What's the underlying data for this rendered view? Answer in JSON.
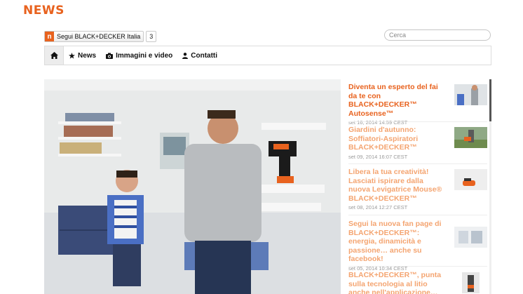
{
  "header": {
    "title": "NEWS"
  },
  "follow": {
    "logo": "n",
    "label": "Segui BLACK+DECKER Italia",
    "count": "3"
  },
  "search": {
    "placeholder": "Cerca"
  },
  "nav": {
    "home_icon": "home-icon",
    "items": [
      {
        "label": "News",
        "icon": "star-icon"
      },
      {
        "label": "Immagini e video",
        "icon": "camera-icon"
      },
      {
        "label": "Contatti",
        "icon": "user-icon"
      }
    ]
  },
  "hero": {
    "image": "man-and-boy-with-drill-at-shelf-photo"
  },
  "articles": [
    {
      "title": "Diventa un esperto del fai da te con BLACK+DECKER™ Autosense™",
      "date": "set 16, 2014 14:59 CEST",
      "active": true,
      "thumb": "man-with-tool-thumbnail"
    },
    {
      "title": "Giardini d'autunno: Soffiatori-Aspiratori BLACK+DECKER™",
      "date": "set 09, 2014 16:07 CEST",
      "active": false,
      "thumb": "garden-blower-thumbnail"
    },
    {
      "title": "Libera la tua creatività! Lasciati ispirare dalla nuova Levigatrice Mouse® BLACK+DECKER™",
      "date": "set 08, 2014 12:27 CEST",
      "active": false,
      "thumb": "sander-mouse-thumbnail"
    },
    {
      "title": "Segui la nuova fan page di BLACK+DECKER™: energia, dinamicità e passione… anche su facebook!",
      "date": "set 05, 2014 10:34 CEST",
      "active": false,
      "thumb": "fan-page-thumbnail"
    },
    {
      "title": "BLACK+DECKER™, punta sulla tecnologia al litio anche nell'applicazione…",
      "date": "",
      "active": false,
      "thumb": "lithium-tool-thumbnail"
    }
  ],
  "colors": {
    "accent": "#e8621e",
    "accent_light": "#f4a470",
    "date": "#9a9a9a"
  }
}
